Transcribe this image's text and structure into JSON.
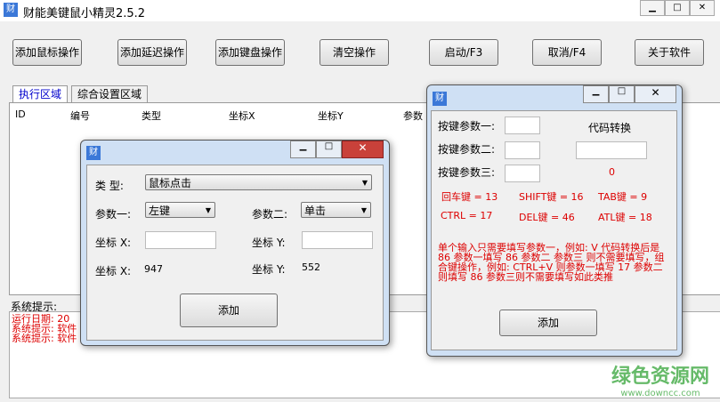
{
  "window": {
    "title": "财能美键鼠小精灵2.5.2",
    "icon": "财"
  },
  "toolbar": [
    "添加鼠标操作",
    "添加延迟操作",
    "添加键盘操作",
    "清空操作",
    "启动/F3",
    "取消/F4",
    "关于软件"
  ],
  "tabs": [
    "执行区域",
    "综合设置区域"
  ],
  "table": {
    "headers": [
      "ID",
      "编号",
      "类型",
      "坐标X",
      "坐标Y",
      "参数"
    ]
  },
  "log": {
    "label": "系统提示:",
    "lines": [
      "运行日期:  20",
      "系统提示: 软件",
      "系统提示: 软件"
    ]
  },
  "mouse_dialog": {
    "type_label": "类  型:",
    "type_value": "鼠标点击",
    "p1_label": "参数一:",
    "p1_value": "左键",
    "p2_label": "参数二:",
    "p2_value": "单击",
    "x_label": "坐标 X:",
    "y_label": "坐标 Y:",
    "x_value": "947",
    "y_value": "552",
    "add": "添加"
  },
  "key_dialog": {
    "p1": "按键参数一:",
    "p2": "按键参数二:",
    "p3": "按键参数三:",
    "convert": "代码转换",
    "result": "0",
    "codes": [
      "回车键 = 13",
      "SHIFT键 = 16",
      "TAB键 = 9",
      "CTRL = 17",
      "DEL键 = 46",
      "ATL键 = 18"
    ],
    "help": "单个输入只需要填写参数一，例如: V 代码转换后是 86 参数一填写 86 参数二 参数三 则不需要填写，组合键操作，例如: CTRL+V 则参数一填写 17 参数二 则填写 86 参数三则不需要填写如此类推",
    "add": "添加"
  },
  "watermark": {
    "name": "绿色资源网",
    "url": "www.downcc.com"
  }
}
